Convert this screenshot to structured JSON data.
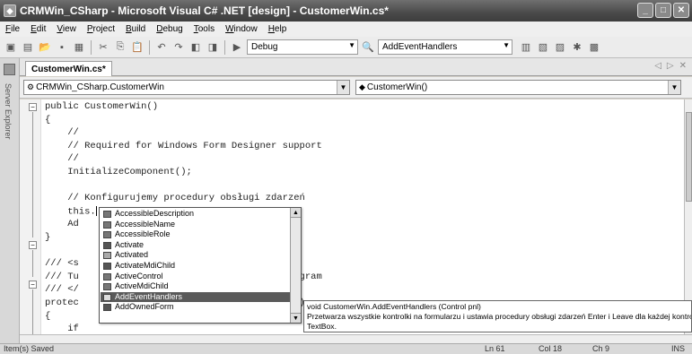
{
  "window": {
    "title": "CRMWin_CSharp - Microsoft Visual C# .NET [design] - CustomerWin.cs*"
  },
  "menu": [
    "File",
    "Edit",
    "View",
    "Project",
    "Build",
    "Debug",
    "Tools",
    "Window",
    "Help"
  ],
  "toolbar": {
    "config_value": "Debug",
    "find_value": "AddEventHandlers"
  },
  "sidebar": {
    "server_explorer_label": "Server Explorer"
  },
  "tabs": [
    {
      "label": "CustomerWin.cs*"
    }
  ],
  "nav": {
    "class_value": "CRMWin_CSharp.CustomerWin",
    "member_value": "CustomerWin()"
  },
  "code_lines": [
    "public CustomerWin()",
    "{",
    "    //",
    "    // Required for Windows Form Designer support",
    "    //",
    "    InitializeComponent();",
    "",
    "    // Konfigurujemy procedury obsługi zdarzeń",
    "    this.",
    "    Ad",
    "}",
    "",
    "/// <s",
    "/// Tu                                    program",
    "/// </",
    "protec                                  sing )",
    "{",
    "    if",
    "    {"
  ],
  "intellisense": {
    "items": [
      "AccessibleDescription",
      "AccessibleName",
      "AccessibleRole",
      "Activate",
      "Activated",
      "ActivateMdiChild",
      "ActiveControl",
      "ActiveMdiChild",
      "AddEventHandlers",
      "AddOwnedForm"
    ],
    "selected_index": 8
  },
  "tooltip": {
    "line1": "void CustomerWin.AddEventHandlers (Control pnl)",
    "line2": "Przetwarza wszystkie kontrolki na formularzu i ustawia procedury obsługi zdarzeń Enter i Leave dla każdej kontrolki",
    "line3": "TextBox."
  },
  "status": {
    "message": "Item(s) Saved",
    "ln": "Ln 61",
    "col": "Col 18",
    "ch": "Ch 9",
    "mode": "INS"
  }
}
